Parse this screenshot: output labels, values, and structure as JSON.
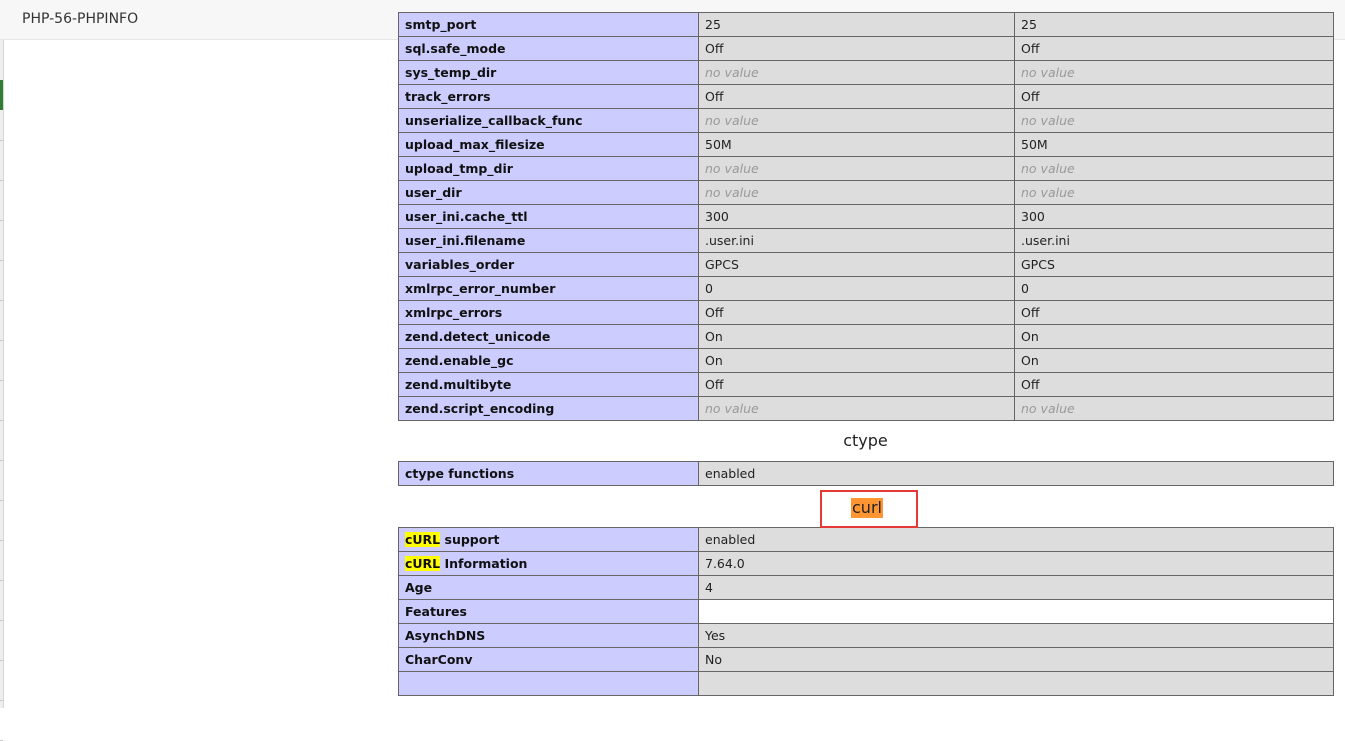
{
  "window": {
    "title": "PHP-56-PHPINFO"
  },
  "core_rows": [
    {
      "name": "smtp_port",
      "local": "25",
      "master": "25",
      "novalue": false
    },
    {
      "name": "sql.safe_mode",
      "local": "Off",
      "master": "Off",
      "novalue": false
    },
    {
      "name": "sys_temp_dir",
      "local": "no value",
      "master": "no value",
      "novalue": true
    },
    {
      "name": "track_errors",
      "local": "Off",
      "master": "Off",
      "novalue": false
    },
    {
      "name": "unserialize_callback_func",
      "local": "no value",
      "master": "no value",
      "novalue": true
    },
    {
      "name": "upload_max_filesize",
      "local": "50M",
      "master": "50M",
      "novalue": false
    },
    {
      "name": "upload_tmp_dir",
      "local": "no value",
      "master": "no value",
      "novalue": true
    },
    {
      "name": "user_dir",
      "local": "no value",
      "master": "no value",
      "novalue": true
    },
    {
      "name": "user_ini.cache_ttl",
      "local": "300",
      "master": "300",
      "novalue": false
    },
    {
      "name": "user_ini.filename",
      "local": ".user.ini",
      "master": ".user.ini",
      "novalue": false
    },
    {
      "name": "variables_order",
      "local": "GPCS",
      "master": "GPCS",
      "novalue": false
    },
    {
      "name": "xmlrpc_error_number",
      "local": "0",
      "master": "0",
      "novalue": false
    },
    {
      "name": "xmlrpc_errors",
      "local": "Off",
      "master": "Off",
      "novalue": false
    },
    {
      "name": "zend.detect_unicode",
      "local": "On",
      "master": "On",
      "novalue": false
    },
    {
      "name": "zend.enable_gc",
      "local": "On",
      "master": "On",
      "novalue": false
    },
    {
      "name": "zend.multibyte",
      "local": "Off",
      "master": "Off",
      "novalue": false
    },
    {
      "name": "zend.script_encoding",
      "local": "no value",
      "master": "no value",
      "novalue": true
    }
  ],
  "ctype": {
    "title": "ctype",
    "rows": [
      {
        "name": "ctype functions",
        "value": "enabled"
      }
    ]
  },
  "curl": {
    "title": "curl",
    "highlight_word": "cURL",
    "highlight_color": "#ffff00",
    "title_highlight_color": "#ff9632",
    "box_color": "#e53935",
    "rows": [
      {
        "hl": "cURL",
        "name": " support",
        "value": "enabled"
      },
      {
        "hl": "cURL",
        "name": " Information",
        "value": "7.64.0"
      },
      {
        "hl": "",
        "name": "Age",
        "value": "4"
      },
      {
        "hl": "",
        "name": "Features",
        "value": "",
        "white": true
      },
      {
        "hl": "",
        "name": "AsynchDNS",
        "value": "Yes"
      },
      {
        "hl": "",
        "name": "CharConv",
        "value": "No"
      },
      {
        "hl": "",
        "name": "",
        "value": ""
      }
    ]
  },
  "colors": {
    "entry_bg": "#ccccff",
    "value_bg": "#dddddd",
    "border": "#666666"
  }
}
